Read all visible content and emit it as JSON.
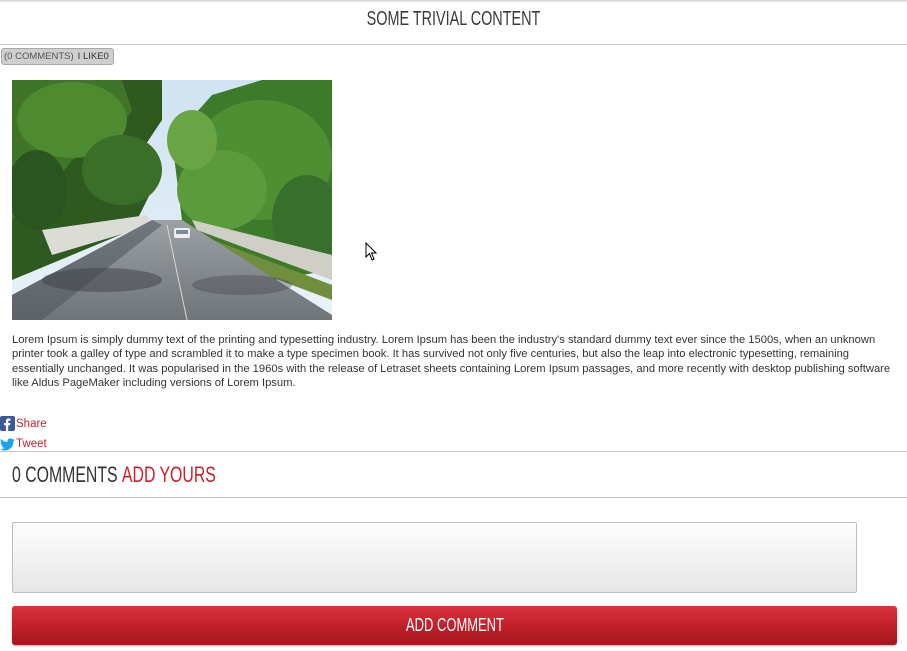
{
  "article": {
    "title": "SOME TRIVIAL CONTENT",
    "comments_meta": "(0 COMMENTS)",
    "like_label": "I LIKE",
    "like_count": "0",
    "body": "Lorem Ipsum is simply dummy text of the printing and typesetting industry. Lorem Ipsum has been the industry's standard dummy text ever since the 1500s, when an unknown printer took a galley of type and scrambled it to make a type specimen book. It has survived not only five centuries, but also the leap into electronic typesetting, remaining essentially unchanged. It was popularised in the 1960s with the release of Letraset sheets containing Lorem Ipsum passages, and more recently with desktop publishing software like Aldus PageMaker including versions of Lorem Ipsum."
  },
  "social": {
    "share_label": "Share",
    "share_icon": "facebook-icon",
    "tweet_label": "Tweet",
    "tweet_icon": "twitter-icon"
  },
  "comments": {
    "count_label": "0 COMMENTS",
    "add_yours_label": "ADD YOURS",
    "input_value": "",
    "button_label": "ADD COMMENT"
  },
  "colors": {
    "accent": "#c8202a",
    "text": "#333333"
  }
}
